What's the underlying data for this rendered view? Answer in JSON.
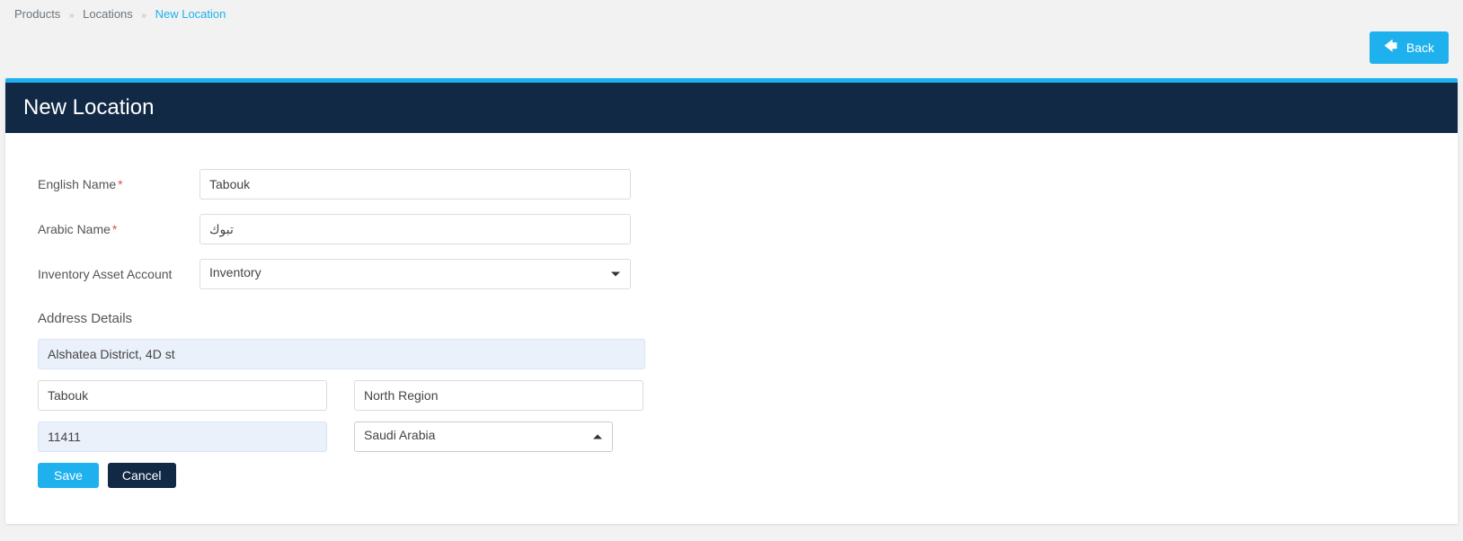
{
  "breadcrumb": {
    "items": [
      "Products",
      "Locations",
      "New Location"
    ]
  },
  "topbar": {
    "back_label": "Back"
  },
  "header": {
    "title": "New Location"
  },
  "form": {
    "english_name": {
      "label": "English Name",
      "value": "Tabouk"
    },
    "arabic_name": {
      "label": "Arabic Name",
      "value": "تبوك"
    },
    "inventory_account": {
      "label": "Inventory Asset Account",
      "selected": "Inventory"
    },
    "address_section_title": "Address Details",
    "address": {
      "street": "Alshatea District, 4D st",
      "city": "Tabouk",
      "region": "North Region",
      "postal": "11411",
      "country": "Saudi Arabia"
    },
    "buttons": {
      "save": "Save",
      "cancel": "Cancel"
    }
  }
}
